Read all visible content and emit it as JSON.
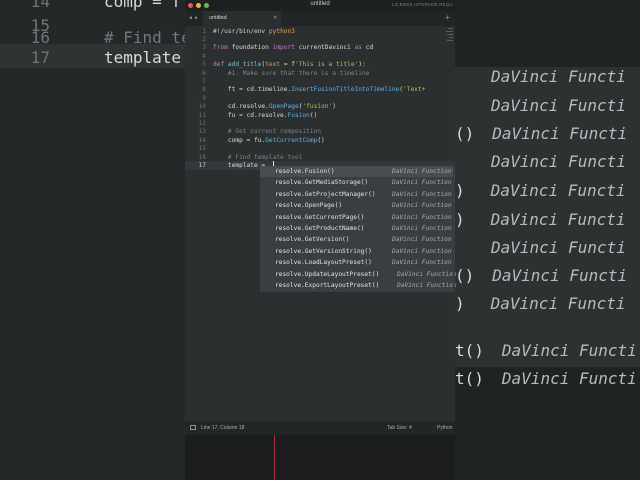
{
  "window": {
    "title": "untitled",
    "license_notice": "LICENSE UPGRADE REQU",
    "tab_label": "untitled",
    "tab_close": "×",
    "new_tab": "+",
    "nav_arrows": "◀ ▶"
  },
  "code_lines": [
    {
      "n": "1",
      "parts": [
        {
          "t": "#!/usr/bin/env ",
          "c": "shebang"
        },
        {
          "t": "python3",
          "c": "var"
        }
      ]
    },
    {
      "n": "2",
      "parts": []
    },
    {
      "n": "3",
      "parts": [
        {
          "t": "from",
          "c": "kw"
        },
        {
          "t": " foundation ",
          "c": ""
        },
        {
          "t": "import",
          "c": "kw"
        },
        {
          "t": " currentDavinci ",
          "c": ""
        },
        {
          "t": "as",
          "c": "kw"
        },
        {
          "t": " cd",
          "c": ""
        }
      ]
    },
    {
      "n": "4",
      "parts": []
    },
    {
      "n": "5",
      "parts": [
        {
          "t": "def",
          "c": "kw"
        },
        {
          "t": " ",
          "c": ""
        },
        {
          "t": "add_title",
          "c": "fn"
        },
        {
          "t": "(",
          "c": ""
        },
        {
          "t": "text",
          "c": "var"
        },
        {
          "t": " = f",
          "c": ""
        },
        {
          "t": "'This is a title'",
          "c": "str"
        },
        {
          "t": "):",
          "c": ""
        }
      ]
    },
    {
      "n": "6",
      "parts": [
        {
          "t": "    #1. Make sure that there is a timeline",
          "c": "cmt"
        }
      ]
    },
    {
      "n": "7",
      "parts": []
    },
    {
      "n": "8",
      "parts": [
        {
          "t": "    ft = cd.timeline.",
          "c": ""
        },
        {
          "t": "InsertFusionTitleIntoTimeline",
          "c": "meth"
        },
        {
          "t": "(",
          "c": ""
        },
        {
          "t": "'Text+",
          "c": "str"
        }
      ]
    },
    {
      "n": "9",
      "parts": []
    },
    {
      "n": "10",
      "parts": [
        {
          "t": "    cd.resolve.",
          "c": ""
        },
        {
          "t": "OpenPage",
          "c": "meth"
        },
        {
          "t": "(",
          "c": ""
        },
        {
          "t": "'fusion'",
          "c": "str"
        },
        {
          "t": ")",
          "c": ""
        }
      ]
    },
    {
      "n": "11",
      "parts": [
        {
          "t": "    fu = cd.resolve.",
          "c": ""
        },
        {
          "t": "Fusion",
          "c": "meth"
        },
        {
          "t": "()",
          "c": ""
        }
      ]
    },
    {
      "n": "12",
      "parts": []
    },
    {
      "n": "13",
      "parts": [
        {
          "t": "    # Get current composition",
          "c": "cmt"
        }
      ]
    },
    {
      "n": "14",
      "parts": [
        {
          "t": "    comp = fu.",
          "c": ""
        },
        {
          "t": "GetCurrentComp",
          "c": "meth"
        },
        {
          "t": "()",
          "c": ""
        }
      ]
    },
    {
      "n": "15",
      "parts": []
    },
    {
      "n": "16",
      "parts": [
        {
          "t": "    # Find template tool",
          "c": "cmt"
        }
      ]
    },
    {
      "n": "17",
      "parts": [
        {
          "t": "    template = ",
          "c": ""
        }
      ]
    }
  ],
  "autocomplete": [
    {
      "method": "resolve.Fusion()",
      "type": "DaVinci Function"
    },
    {
      "method": "resolve.GetMediaStorage()",
      "type": "DaVinci Function"
    },
    {
      "method": "resolve.GetProjectManager()",
      "type": "DaVinci Function"
    },
    {
      "method": "resolve.OpenPage()",
      "type": "DaVinci Function"
    },
    {
      "method": "resolve.GetCurrentPage()",
      "type": "DaVinci Function"
    },
    {
      "method": "resolve.GetProductName()",
      "type": "DaVinci Function"
    },
    {
      "method": "resolve.GetVersion()",
      "type": "DaVinci Function"
    },
    {
      "method": "resolve.GetVersionString()",
      "type": "DaVinci Function"
    },
    {
      "method": "resolve.LoadLayoutPreset()",
      "type": "DaVinci Function"
    },
    {
      "method": "resolve.UpdateLayoutPreset()",
      "type": "DaVinci Function"
    },
    {
      "method": "resolve.ExportLayoutPreset()",
      "type": "DaVinci Function"
    }
  ],
  "status": {
    "position": "Line 17, Column 18",
    "tab_size": "Tab Size: 4",
    "syntax": "Python"
  },
  "background": {
    "left_lines": [
      {
        "n": "14",
        "text": "comp = f"
      },
      {
        "n": "15",
        "text": ""
      },
      {
        "n": "16",
        "text": "# Find te"
      },
      {
        "n": "17",
        "text": "template"
      }
    ],
    "right_items": [
      {
        "m": "",
        "t": "DaVinci Functi"
      },
      {
        "m": "",
        "t": "DaVinci Functi"
      },
      {
        "m": "()",
        "t": "DaVinci Functi"
      },
      {
        "m": "",
        "t": "DaVinci Functi"
      },
      {
        "m": ")",
        "t": "DaVinci Functi"
      },
      {
        "m": ")",
        "t": "DaVinci Functi"
      },
      {
        "m": "",
        "t": "DaVinci Functi"
      },
      {
        "m": "()",
        "t": "DaVinci Functi"
      },
      {
        "m": ")",
        "t": "DaVinci Functi"
      },
      {
        "m": "t()",
        "t": "DaVinci Functi"
      },
      {
        "m": "t()",
        "t": "DaVinci Functi"
      }
    ]
  }
}
